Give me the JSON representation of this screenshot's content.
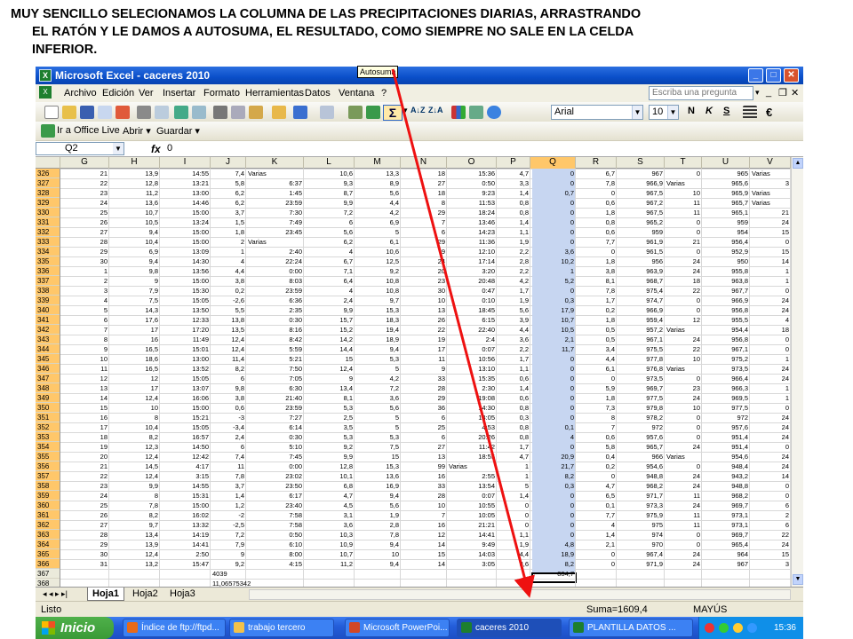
{
  "caption": {
    "line1": "MUY SENCILLO SELECIONAMOS LA COLUMNA DE LAS PRECIPITACIONES DIARIAS, ARRASTRANDO",
    "line2": "EL RATÓN Y LE DAMOS A AUTOSUMA, EL RESULTADO, COMO SIEMPRE NO SALE EN LA CELDA",
    "line3": "INFERIOR."
  },
  "window": {
    "title": "Microsoft Excel - caceres 2010",
    "minimize": "_",
    "maximize": "□",
    "close": "✕"
  },
  "menu": {
    "items": [
      "Archivo",
      "Edición",
      "Ver",
      "Insertar",
      "Formato",
      "Herramientas",
      "Datos",
      "Ventana",
      "?"
    ],
    "ask_placeholder": "Escriba una pregunta",
    "ctrl_min": "_",
    "ctrl_restore": "❐",
    "ctrl_close": "✕"
  },
  "toolbar": {
    "font": "Arial",
    "size": "10",
    "bold": "N",
    "italic": "K",
    "underline": "S",
    "euro": "€",
    "sigma": "Σ",
    "office_live": "Ir a Office Live",
    "abrir": "Abrir ▾",
    "guardar": "Guardar ▾",
    "tooltip": "Autosuma",
    "sort_asc": "A↓Z",
    "sort_desc": "Z↓A"
  },
  "formula": {
    "cell": "Q2",
    "fx": "fx",
    "value": "0"
  },
  "columns": [
    "G",
    "H",
    "I",
    "J",
    "K",
    "L",
    "M",
    "N",
    "O",
    "P",
    "Q",
    "R",
    "S",
    "T",
    "U",
    "V"
  ],
  "rows": [
    {
      "n": "326",
      "c": [
        "21",
        "13,9",
        "14:55",
        "7,4",
        "Varias",
        "10,6",
        "13,3",
        "18",
        "15:36",
        "4,7",
        "0",
        "6,7",
        "967",
        "0",
        "965",
        "Varias"
      ]
    },
    {
      "n": "327",
      "c": [
        "22",
        "12,8",
        "13:21",
        "5,8",
        "6:37",
        "9,3",
        "8,9",
        "27",
        "0:50",
        "3,3",
        "0",
        "7,8",
        "966,9",
        "Varias",
        "965,6",
        "3"
      ]
    },
    {
      "n": "328",
      "c": [
        "23",
        "11,2",
        "13:00",
        "6,2",
        "1:45",
        "8,7",
        "5,6",
        "18",
        "9:23",
        "1,4",
        "0,7",
        "0",
        "967,5",
        "10",
        "965,9",
        "Varias"
      ]
    },
    {
      "n": "329",
      "c": [
        "24",
        "13,6",
        "14:46",
        "6,2",
        "23:59",
        "9,9",
        "4,4",
        "8",
        "11:53",
        "0,8",
        "0",
        "0,6",
        "967,2",
        "11",
        "965,7",
        "Varias"
      ]
    },
    {
      "n": "330",
      "c": [
        "25",
        "10,7",
        "15:00",
        "3,7",
        "7:30",
        "7,2",
        "4,2",
        "29",
        "18:24",
        "0,8",
        "0",
        "1,8",
        "967,5",
        "11",
        "965,1",
        "21"
      ]
    },
    {
      "n": "331",
      "c": [
        "26",
        "10,5",
        "13:24",
        "1,5",
        "7:49",
        "6",
        "6,9",
        "7",
        "13:46",
        "1,4",
        "0",
        "0,8",
        "965,2",
        "0",
        "959",
        "24"
      ]
    },
    {
      "n": "332",
      "c": [
        "27",
        "9,4",
        "15:00",
        "1,8",
        "23:45",
        "5,6",
        "5",
        "6",
        "14:23",
        "1,1",
        "0",
        "0,6",
        "959",
        "0",
        "954",
        "15"
      ]
    },
    {
      "n": "333",
      "c": [
        "28",
        "10,4",
        "15:00",
        "2",
        "Varias",
        "6,2",
        "6,1",
        "29",
        "11:36",
        "1,9",
        "0",
        "7,7",
        "961,9",
        "21",
        "956,4",
        "0"
      ]
    },
    {
      "n": "334",
      "c": [
        "29",
        "6,9",
        "13:09",
        "1",
        "2:40",
        "4",
        "10,6",
        "9",
        "12:10",
        "2,2",
        "3,6",
        "0",
        "961,5",
        "0",
        "952,9",
        "15"
      ]
    },
    {
      "n": "335",
      "c": [
        "30",
        "9,4",
        "14:30",
        "4",
        "22:24",
        "6,7",
        "12,5",
        "24",
        "17:14",
        "2,8",
        "10,2",
        "1,8",
        "956",
        "24",
        "950",
        "14"
      ]
    },
    {
      "n": "336",
      "c": [
        "1",
        "9,8",
        "13:56",
        "4,4",
        "0:00",
        "7,1",
        "9,2",
        "20",
        "3:20",
        "2,2",
        "1",
        "3,8",
        "963,9",
        "24",
        "955,8",
        "1"
      ]
    },
    {
      "n": "337",
      "c": [
        "2",
        "9",
        "15:00",
        "3,8",
        "8:03",
        "6,4",
        "10,8",
        "23",
        "20:48",
        "4,2",
        "5,2",
        "8,1",
        "968,7",
        "18",
        "963,8",
        "1"
      ]
    },
    {
      "n": "338",
      "c": [
        "3",
        "7,9",
        "15:30",
        "0,2",
        "23:59",
        "4",
        "10,8",
        "30",
        "0:47",
        "1,7",
        "0",
        "7,8",
        "975,4",
        "22",
        "967,7",
        "0"
      ]
    },
    {
      "n": "339",
      "c": [
        "4",
        "7,5",
        "15:05",
        "-2,6",
        "6:36",
        "2,4",
        "9,7",
        "10",
        "0:10",
        "1,9",
        "0,3",
        "1,7",
        "974,7",
        "0",
        "966,9",
        "24"
      ]
    },
    {
      "n": "340",
      "c": [
        "5",
        "14,3",
        "13:50",
        "5,5",
        "2:35",
        "9,9",
        "15,3",
        "13",
        "18:45",
        "5,6",
        "17,9",
        "0,2",
        "966,9",
        "0",
        "956,8",
        "24"
      ]
    },
    {
      "n": "341",
      "c": [
        "6",
        "17,6",
        "12:33",
        "13,8",
        "0:30",
        "15,7",
        "18,3",
        "26",
        "6:15",
        "3,9",
        "10,7",
        "1,8",
        "959,4",
        "12",
        "955,5",
        "4"
      ]
    },
    {
      "n": "342",
      "c": [
        "7",
        "17",
        "17:20",
        "13,5",
        "8:16",
        "15,2",
        "19,4",
        "22",
        "22:40",
        "4,4",
        "10,5",
        "0,5",
        "957,2",
        "Varias",
        "954,4",
        "18"
      ]
    },
    {
      "n": "343",
      "c": [
        "8",
        "16",
        "11:49",
        "12,4",
        "8:42",
        "14,2",
        "18,9",
        "19",
        "2:4",
        "3,6",
        "2,1",
        "0,5",
        "967,1",
        "24",
        "956,8",
        "0"
      ]
    },
    {
      "n": "344",
      "c": [
        "9",
        "16,5",
        "15:01",
        "12,4",
        "5:59",
        "14,4",
        "9,4",
        "17",
        "0:07",
        "2,2",
        "11,7",
        "3,4",
        "975,5",
        "22",
        "967,1",
        "0"
      ]
    },
    {
      "n": "345",
      "c": [
        "10",
        "18,6",
        "13:00",
        "11,4",
        "5:21",
        "15",
        "5,3",
        "11",
        "10:56",
        "1,7",
        "0",
        "4,4",
        "977,8",
        "10",
        "975,2",
        "1"
      ]
    },
    {
      "n": "346",
      "c": [
        "11",
        "16,5",
        "13:52",
        "8,2",
        "7:50",
        "12,4",
        "5",
        "9",
        "13:10",
        "1,1",
        "0",
        "6,1",
        "976,8",
        "Varias",
        "973,5",
        "24"
      ]
    },
    {
      "n": "347",
      "c": [
        "12",
        "12",
        "15:05",
        "6",
        "7:05",
        "9",
        "4,2",
        "33",
        "15:35",
        "0,6",
        "0",
        "0",
        "973,5",
        "0",
        "966,4",
        "24"
      ]
    },
    {
      "n": "348",
      "c": [
        "13",
        "17",
        "13:07",
        "9,8",
        "6:30",
        "13,4",
        "7,2",
        "28",
        "2:30",
        "1,4",
        "0",
        "5,9",
        "969,7",
        "23",
        "966,3",
        "1"
      ]
    },
    {
      "n": "349",
      "c": [
        "14",
        "12,4",
        "16:06",
        "3,8",
        "21:40",
        "8,1",
        "3,6",
        "29",
        "19:08",
        "0,6",
        "0",
        "1,8",
        "977,5",
        "24",
        "969,5",
        "1"
      ]
    },
    {
      "n": "350",
      "c": [
        "15",
        "10",
        "15:00",
        "0,6",
        "23:59",
        "5,3",
        "5,6",
        "36",
        "14:30",
        "0,8",
        "0",
        "7,3",
        "979,8",
        "10",
        "977,5",
        "0"
      ]
    },
    {
      "n": "351",
      "c": [
        "16",
        "8",
        "15:21",
        "-3",
        "7:27",
        "2,5",
        "5",
        "6",
        "13:05",
        "0,3",
        "0",
        "8",
        "978,2",
        "0",
        "972",
        "24"
      ]
    },
    {
      "n": "352",
      "c": [
        "17",
        "10,4",
        "15:05",
        "-3,4",
        "6:14",
        "3,5",
        "5",
        "25",
        "4:53",
        "0,8",
        "0,1",
        "7",
        "972",
        "0",
        "957,6",
        "24"
      ]
    },
    {
      "n": "353",
      "c": [
        "18",
        "8,2",
        "16:57",
        "2,4",
        "0:30",
        "5,3",
        "5,3",
        "6",
        "20:26",
        "0,8",
        "4",
        "0,6",
        "957,6",
        "0",
        "951,4",
        "24"
      ]
    },
    {
      "n": "354",
      "c": [
        "19",
        "12,3",
        "14:50",
        "6",
        "5:10",
        "9,2",
        "7,5",
        "27",
        "11:42",
        "1,7",
        "0",
        "5,8",
        "965,7",
        "24",
        "951,4",
        "0"
      ]
    },
    {
      "n": "355",
      "c": [
        "20",
        "12,4",
        "12:42",
        "7,4",
        "7:45",
        "9,9",
        "15",
        "13",
        "18:55",
        "4,7",
        "20,9",
        "0,4",
        "966",
        "Varias",
        "954,6",
        "24"
      ]
    },
    {
      "n": "356",
      "c": [
        "21",
        "14,5",
        "4:17",
        "11",
        "0:00",
        "12,8",
        "15,3",
        "99",
        "Varias",
        "1",
        "21,7",
        "0,2",
        "954,6",
        "0",
        "948,4",
        "24"
      ]
    },
    {
      "n": "357",
      "c": [
        "22",
        "12,4",
        "3:15",
        "7,8",
        "23:02",
        "10,1",
        "13,6",
        "16",
        "2:55",
        "1",
        "8,2",
        "0",
        "948,8",
        "24",
        "943,2",
        "14"
      ]
    },
    {
      "n": "358",
      "c": [
        "23",
        "9,9",
        "14:55",
        "3,7",
        "23:50",
        "6,8",
        "16,9",
        "33",
        "13:54",
        "5",
        "0,3",
        "4,7",
        "968,2",
        "24",
        "948,8",
        "0"
      ]
    },
    {
      "n": "359",
      "c": [
        "24",
        "8",
        "15:31",
        "1,4",
        "6:17",
        "4,7",
        "9,4",
        "28",
        "0:07",
        "1,4",
        "0",
        "6,5",
        "971,7",
        "11",
        "968,2",
        "0"
      ]
    },
    {
      "n": "360",
      "c": [
        "25",
        "7,8",
        "15:00",
        "1,2",
        "23:40",
        "4,5",
        "5,6",
        "10",
        "10:55",
        "0",
        "0",
        "0,1",
        "973,3",
        "24",
        "969,7",
        "6"
      ]
    },
    {
      "n": "361",
      "c": [
        "26",
        "8,2",
        "16:02",
        "-2",
        "7:58",
        "3,1",
        "1,9",
        "7",
        "10:05",
        "0",
        "0",
        "7,7",
        "975,9",
        "11",
        "973,1",
        "2"
      ]
    },
    {
      "n": "362",
      "c": [
        "27",
        "9,7",
        "13:32",
        "-2,5",
        "7:58",
        "3,6",
        "2,8",
        "16",
        "21:21",
        "0",
        "0",
        "4",
        "975",
        "11",
        "973,1",
        "6"
      ]
    },
    {
      "n": "363",
      "c": [
        "28",
        "13,4",
        "14:19",
        "7,2",
        "0:50",
        "10,3",
        "7,8",
        "12",
        "14:41",
        "1,1",
        "0",
        "1,4",
        "974",
        "0",
        "969,7",
        "22"
      ]
    },
    {
      "n": "364",
      "c": [
        "29",
        "13,9",
        "14:41",
        "7,9",
        "6:10",
        "10,9",
        "9,4",
        "14",
        "9:49",
        "1,9",
        "4,8",
        "2,1",
        "970",
        "0",
        "965,4",
        "24"
      ]
    },
    {
      "n": "365",
      "c": [
        "30",
        "12,4",
        "2:50",
        "9",
        "8:00",
        "10,7",
        "10",
        "15",
        "14:03",
        "4,4",
        "18,9",
        "0",
        "967,4",
        "24",
        "964",
        "15"
      ]
    },
    {
      "n": "366",
      "c": [
        "31",
        "13,2",
        "15:47",
        "9,2",
        "4:15",
        "11,2",
        "9,4",
        "14",
        "3:05",
        "3,6",
        "8,2",
        "0",
        "971,9",
        "24",
        "967",
        "3"
      ]
    },
    {
      "n": "367",
      "c": [
        "",
        "",
        "",
        "4039",
        "",
        "",
        "",
        "",
        "",
        "",
        "804,7",
        "",
        "",
        "",
        "",
        ""
      ]
    },
    {
      "n": "368",
      "c": [
        "",
        "",
        "",
        "11,06575342",
        "",
        "",
        "",
        "",
        "",
        "",
        "",
        "",
        "",
        "",
        "",
        ""
      ]
    },
    {
      "n": "369",
      "c": [
        "",
        "",
        "",
        "",
        "",
        "",
        "",
        "",
        "",
        "",
        "",
        "",
        "",
        "",
        "",
        ""
      ]
    }
  ],
  "sheets": {
    "nav": "◂ ◂ ▸ ▸|",
    "tabs": [
      "Hoja1",
      "Hoja2",
      "Hoja3"
    ]
  },
  "status": {
    "ready": "Listo",
    "sum": "Suma=1609,4",
    "caps": "MAYÚS"
  },
  "taskbar": {
    "start": "Inicio",
    "tasks": [
      "Índice de ftp://ftpd...",
      "trabajo tercero",
      "Microsoft PowerPoi...",
      "caceres 2010",
      "PLANTILLA DATOS ..."
    ],
    "clock": "15:36"
  },
  "colors": {
    "accent": "#245edb",
    "selection": "#c7d6f1",
    "arrow": "#e11"
  }
}
